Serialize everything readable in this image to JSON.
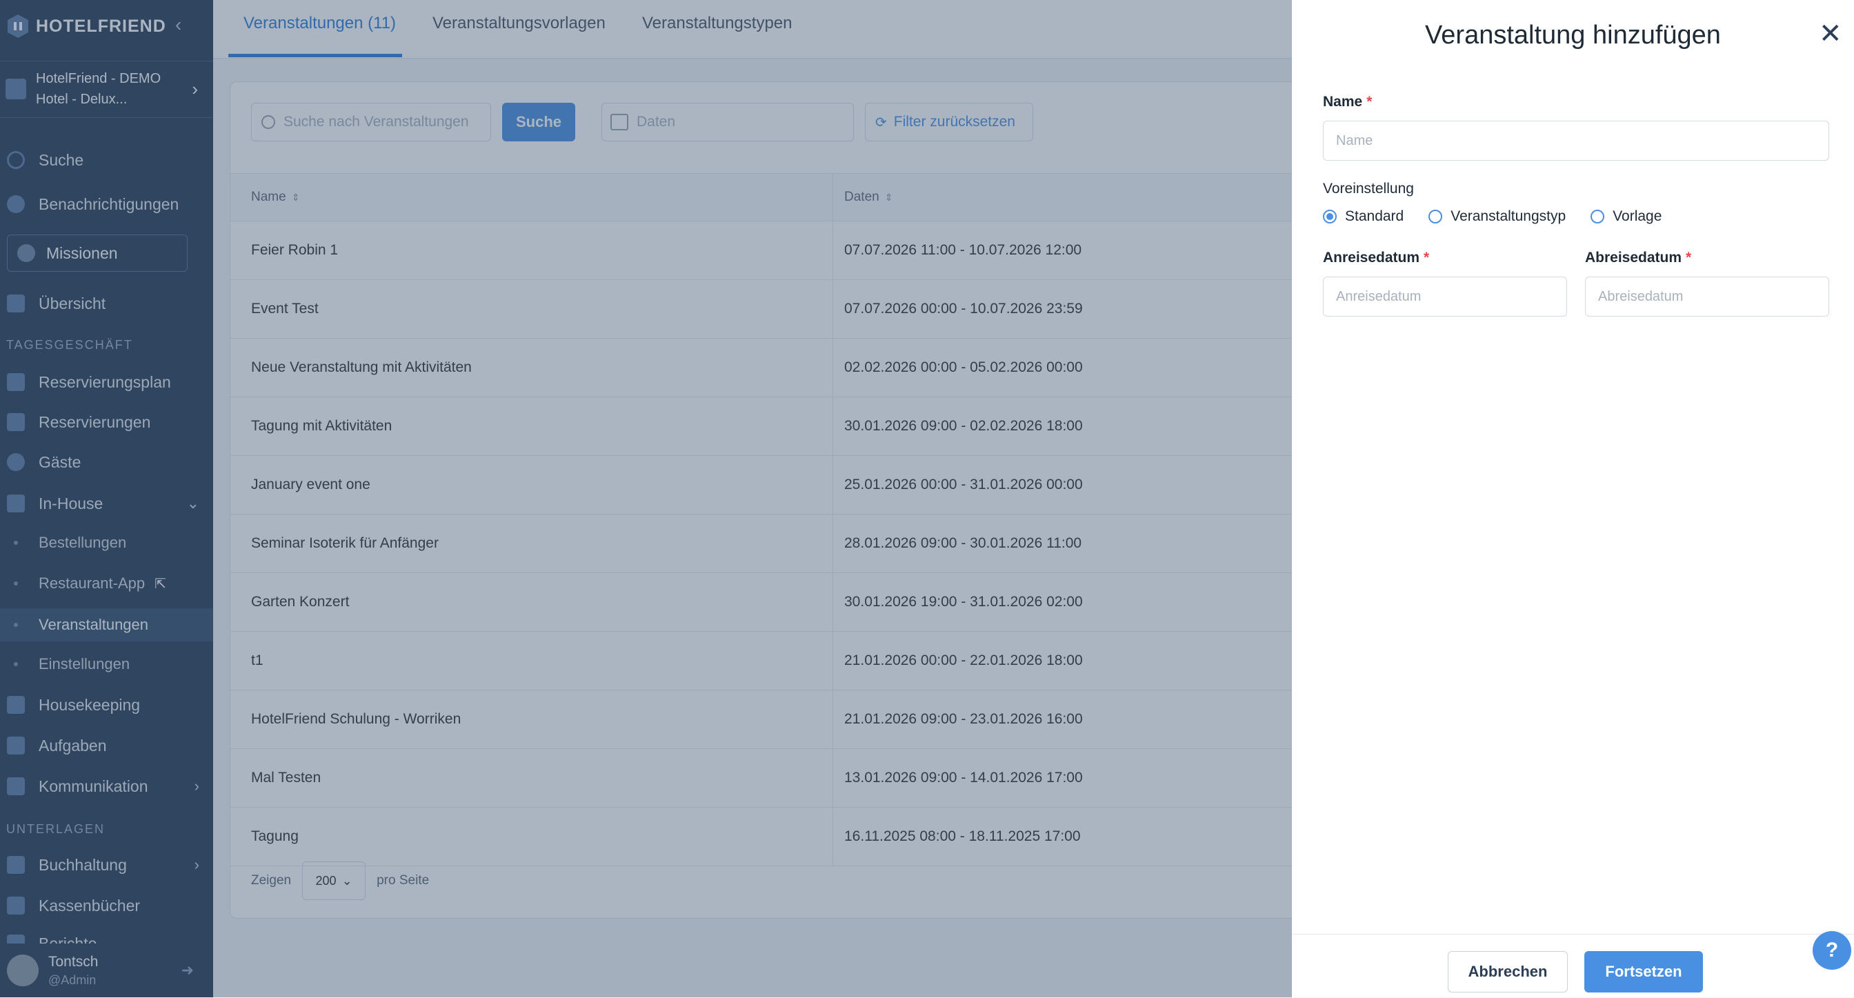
{
  "sidebar": {
    "logo_text": "HOTELFRIEND",
    "logo_mark": "®",
    "hotel_line1": "HotelFriend - DEMO",
    "hotel_line2": "Hotel - Delux...",
    "items": {
      "search": "Suche",
      "notifications": "Benachrichtigungen",
      "missions": "Missionen",
      "overview": "Übersicht",
      "section_daily": "TAGESGESCHÄFT",
      "reservation_plan": "Reservierungsplan",
      "reservations": "Reservierungen",
      "guests": "Gäste",
      "in_house": "In-House",
      "orders": "Bestellungen",
      "restaurant_app": "Restaurant-App",
      "events": "Veranstaltungen",
      "settings": "Einstellungen",
      "housekeeping": "Housekeeping",
      "tasks": "Aufgaben",
      "communication": "Kommunikation",
      "section_docs": "UNTERLAGEN",
      "accounting": "Buchhaltung",
      "cash_books": "Kassenbücher",
      "partial": "Berichte"
    },
    "user": {
      "name": "Tontsch",
      "role": "@Admin"
    }
  },
  "tabs": [
    "Veranstaltungen (11)",
    "Veranstaltungsvorlagen",
    "Veranstaltungstypen"
  ],
  "filters": {
    "search_placeholder": "Suche nach Veranstaltungen",
    "search_button": "Suche",
    "date_placeholder": "Daten",
    "reset_button": "Filter zurücksetzen"
  },
  "table": {
    "headers": [
      "Name",
      "Daten"
    ],
    "rows": [
      {
        "name": "Feier Robin 1",
        "dates": "07.07.2026 11:00 - 10.07.2026 12:00"
      },
      {
        "name": "Event Test",
        "dates": "07.07.2026 00:00 - 10.07.2026 23:59"
      },
      {
        "name": "Neue Veranstaltung mit Aktivitäten",
        "dates": "02.02.2026 00:00 - 05.02.2026 00:00"
      },
      {
        "name": "Tagung mit Aktivitäten",
        "dates": "30.01.2026 09:00 - 02.02.2026 18:00"
      },
      {
        "name": "January event one",
        "dates": "25.01.2026 00:00 - 31.01.2026 00:00"
      },
      {
        "name": "Seminar Isoterik für Anfänger",
        "dates": "28.01.2026 09:00 - 30.01.2026 11:00"
      },
      {
        "name": "Garten Konzert",
        "dates": "30.01.2026 19:00 - 31.01.2026 02:00"
      },
      {
        "name": "t1",
        "dates": "21.01.2026 00:00 - 22.01.2026 18:00"
      },
      {
        "name": "HotelFriend Schulung - Worriken",
        "dates": "21.01.2026 09:00 - 23.01.2026 16:00"
      },
      {
        "name": "Mal Testen",
        "dates": "13.01.2026 09:00 - 14.01.2026 17:00"
      },
      {
        "name": "Tagung",
        "dates": "16.11.2025 08:00 - 18.11.2025 17:00"
      }
    ]
  },
  "pager": {
    "show": "Zeigen",
    "per_page_value": "200",
    "per_page": "pro Seite"
  },
  "drawer": {
    "title": "Veranstaltung hinzufügen",
    "name_label": "Name",
    "name_placeholder": "Name",
    "preset_label": "Voreinstellung",
    "preset_options": [
      "Standard",
      "Veranstaltungstyp",
      "Vorlage"
    ],
    "preset_selected": "Standard",
    "arrival_label": "Anreisedatum",
    "arrival_placeholder": "Anreisedatum",
    "departure_label": "Abreisedatum",
    "departure_placeholder": "Abreisedatum",
    "cancel": "Abbrechen",
    "continue": "Fortsetzen",
    "required_mark": "*"
  },
  "help_label": "?",
  "colors": {
    "accent": "#4a90e2",
    "sidebar": "#2b3e56",
    "required": "#e5484d"
  }
}
